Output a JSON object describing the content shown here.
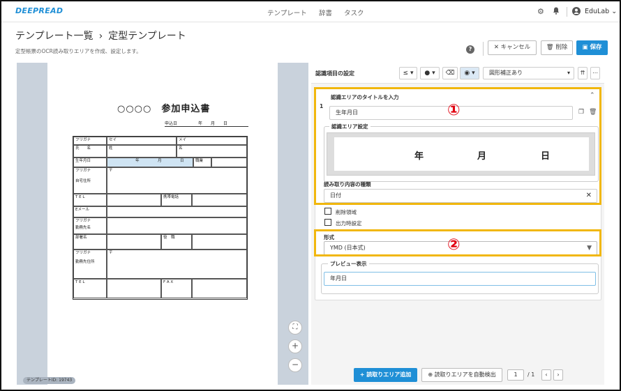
{
  "app": {
    "logo": "DEEPREAD",
    "nav": [
      "テンプレート",
      "辞書",
      "タスク"
    ],
    "user": "EduLab",
    "gear_icon": "gear-icon",
    "bell_icon": "bell-icon",
    "user_icon": "user-circle-icon"
  },
  "breadcrumb": {
    "root": "テンプレート一覧",
    "separator": "›",
    "current": "定型テンプレート"
  },
  "subtitle": "定型帳票のOCR読み取りエリアを作成、設定します。",
  "actions": {
    "help": "?",
    "cancel": "キャンセル",
    "delete": "削除",
    "save": "保存"
  },
  "document": {
    "title": "○○○○　参加申込書",
    "date_line": "申込日　　　　　年　　月　　日",
    "rows": {
      "furigana": "フリガナ",
      "sei": "セイ",
      "mei": "メイ",
      "name": "氏　　名",
      "shi": "姓",
      "mei2": "名",
      "birth": "生年月日",
      "nen": "年",
      "gatsu": "月",
      "nichi": "日",
      "job": "職業",
      "address": "自宅住所",
      "postal": "〒",
      "tel": "T E L",
      "mobile": "携帯電話",
      "email": "Eメール",
      "company": "勤務先名",
      "dept": "部署名",
      "position": "役　職",
      "company_addr": "勤務先住所",
      "fax": "F A X"
    }
  },
  "viewer": {
    "template_id": "テンプレートID: 19743",
    "fit_icon": "fullscreen-icon",
    "zoom_in": "+",
    "zoom_out": "−"
  },
  "panel": {
    "header_label": "認識項目の設定",
    "tool_le": "≤",
    "correction_select": "図形補正あり",
    "item_index": "1",
    "title_label": "認識エリアのタイトルを入力",
    "title_value": "生年月日",
    "area_label": "認識エリア設定",
    "preview_chars": [
      "年",
      "月",
      "日"
    ],
    "content_type_label": "読み取り内容の種類",
    "content_type_value": "日付",
    "checkbox_delete": "削除領域",
    "checkbox_output": "出力時設定",
    "format_label": "形式",
    "format_value": "YMD (日本式)",
    "preview_label": "プレビュー表示",
    "preview_value": "年月日",
    "markers": [
      "①",
      "②"
    ]
  },
  "bottom": {
    "add_area": "読取りエリア追加",
    "auto_detect": "読取りエリアを自動検出",
    "page_current": "1",
    "page_total": "/ 1"
  },
  "colors": {
    "accent": "#1f8fd6",
    "highlight": "#f1b70d",
    "marker": "#e1000f"
  }
}
